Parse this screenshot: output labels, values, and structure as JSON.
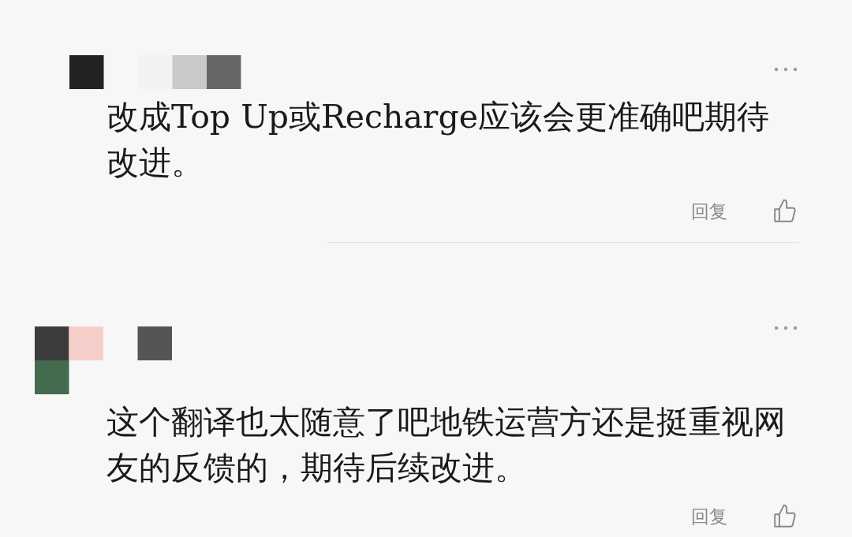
{
  "comments": [
    {
      "text": "改成Top  Up或Recharge应该会更准确吧期待改进。",
      "reply": "回复"
    },
    {
      "text": "这个翻译也太随意了吧地铁运营方还是挺重视网友的反馈的，期待后续改进。",
      "reply": "回复"
    }
  ]
}
